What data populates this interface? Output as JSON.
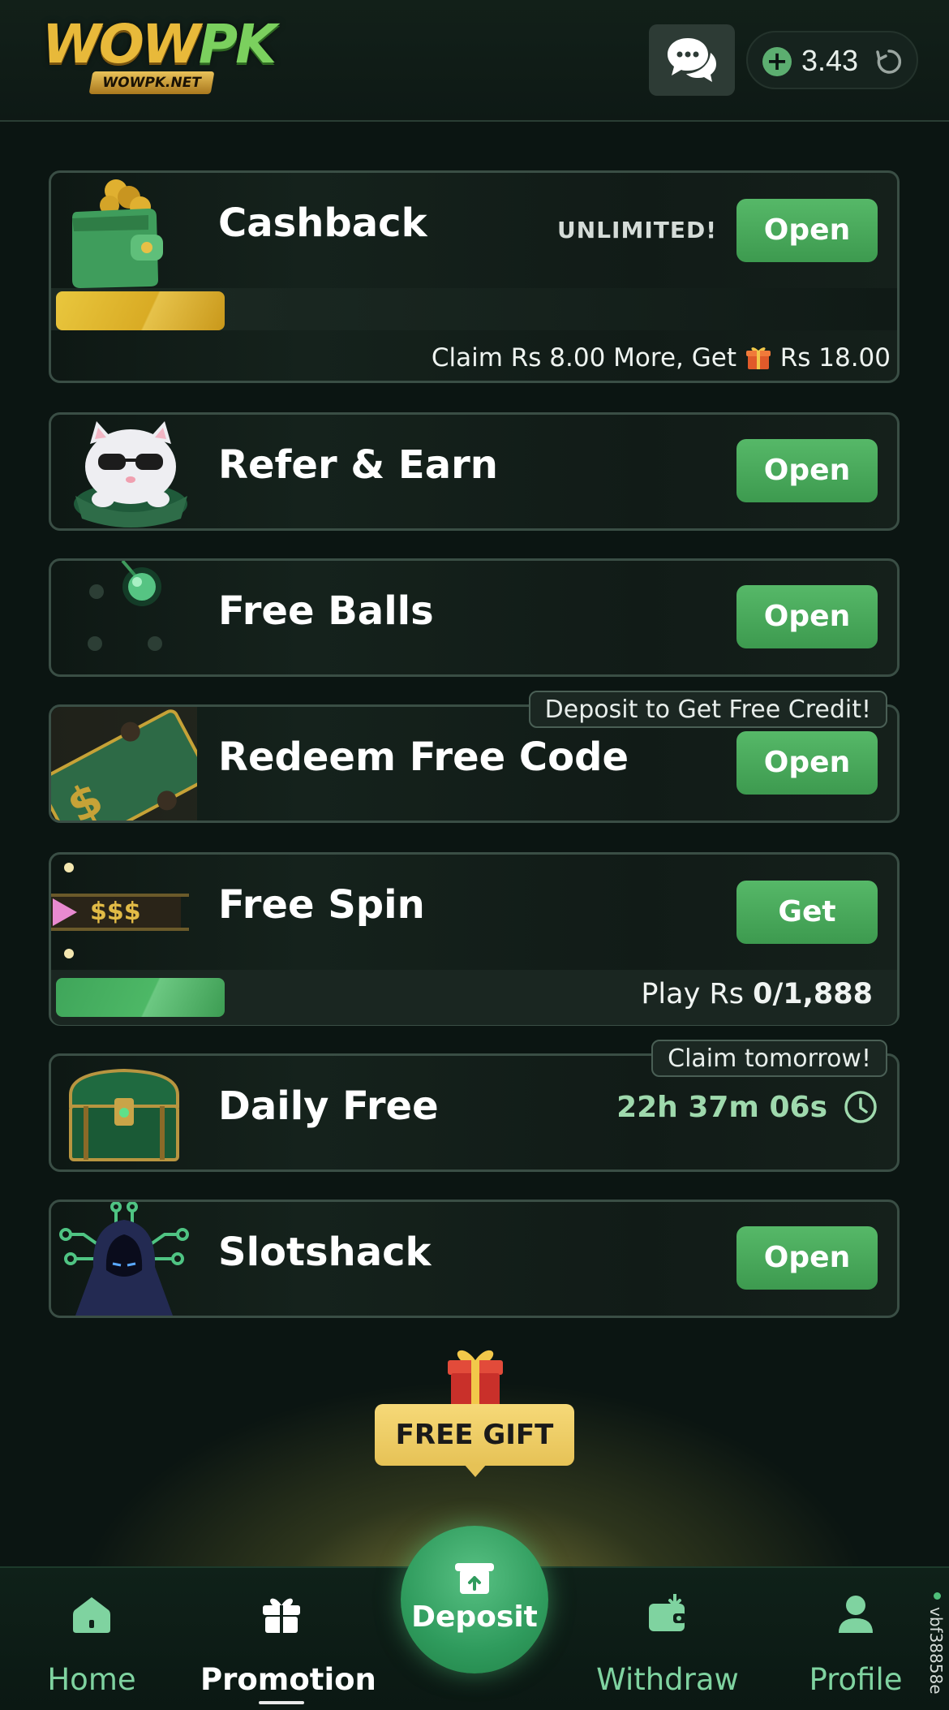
{
  "header": {
    "logo_main": "WOW",
    "logo_accent": "PK",
    "logo_sub": "WOWPK.NET",
    "balance": "3.43",
    "icons": [
      "chat-icon",
      "plus-icon",
      "refresh-icon"
    ]
  },
  "cards": {
    "cashback": {
      "title": "Cashback",
      "badge": "UNLIMITED!",
      "button": "Open",
      "claim_prefix": "Claim Rs 8.00 More, Get",
      "claim_amount": "Rs 18.00",
      "progress_color": "#e3be36"
    },
    "refer": {
      "title": "Refer & Earn",
      "button": "Open"
    },
    "free_balls": {
      "title": "Free Balls",
      "button": "Open"
    },
    "redeem": {
      "title": "Redeem Free Code",
      "button": "Open",
      "tag": "Deposit to Get Free Credit!"
    },
    "free_spin": {
      "title": "Free Spin",
      "button": "Get",
      "thumb_text": "$$$",
      "play_prefix": "Play Rs",
      "play_value": "0/1,888",
      "progress_color": "#4db866"
    },
    "daily_free": {
      "title": "Daily Free",
      "timer": "22h 37m 06s",
      "tag": "Claim tomorrow!"
    },
    "slotshack": {
      "title": "Slotshack",
      "button": "Open"
    }
  },
  "free_gift": {
    "label": "FREE GIFT"
  },
  "nav": {
    "home": "Home",
    "promotion": "Promotion",
    "deposit": "Deposit",
    "withdraw": "Withdraw",
    "profile": "Profile",
    "active": "promotion"
  },
  "side_id": "vbf38858e",
  "colors": {
    "accent_green": "#4caf5f",
    "background": "#0b1512",
    "nav_label": "#7fd3a0",
    "gold": "#e3be36"
  }
}
